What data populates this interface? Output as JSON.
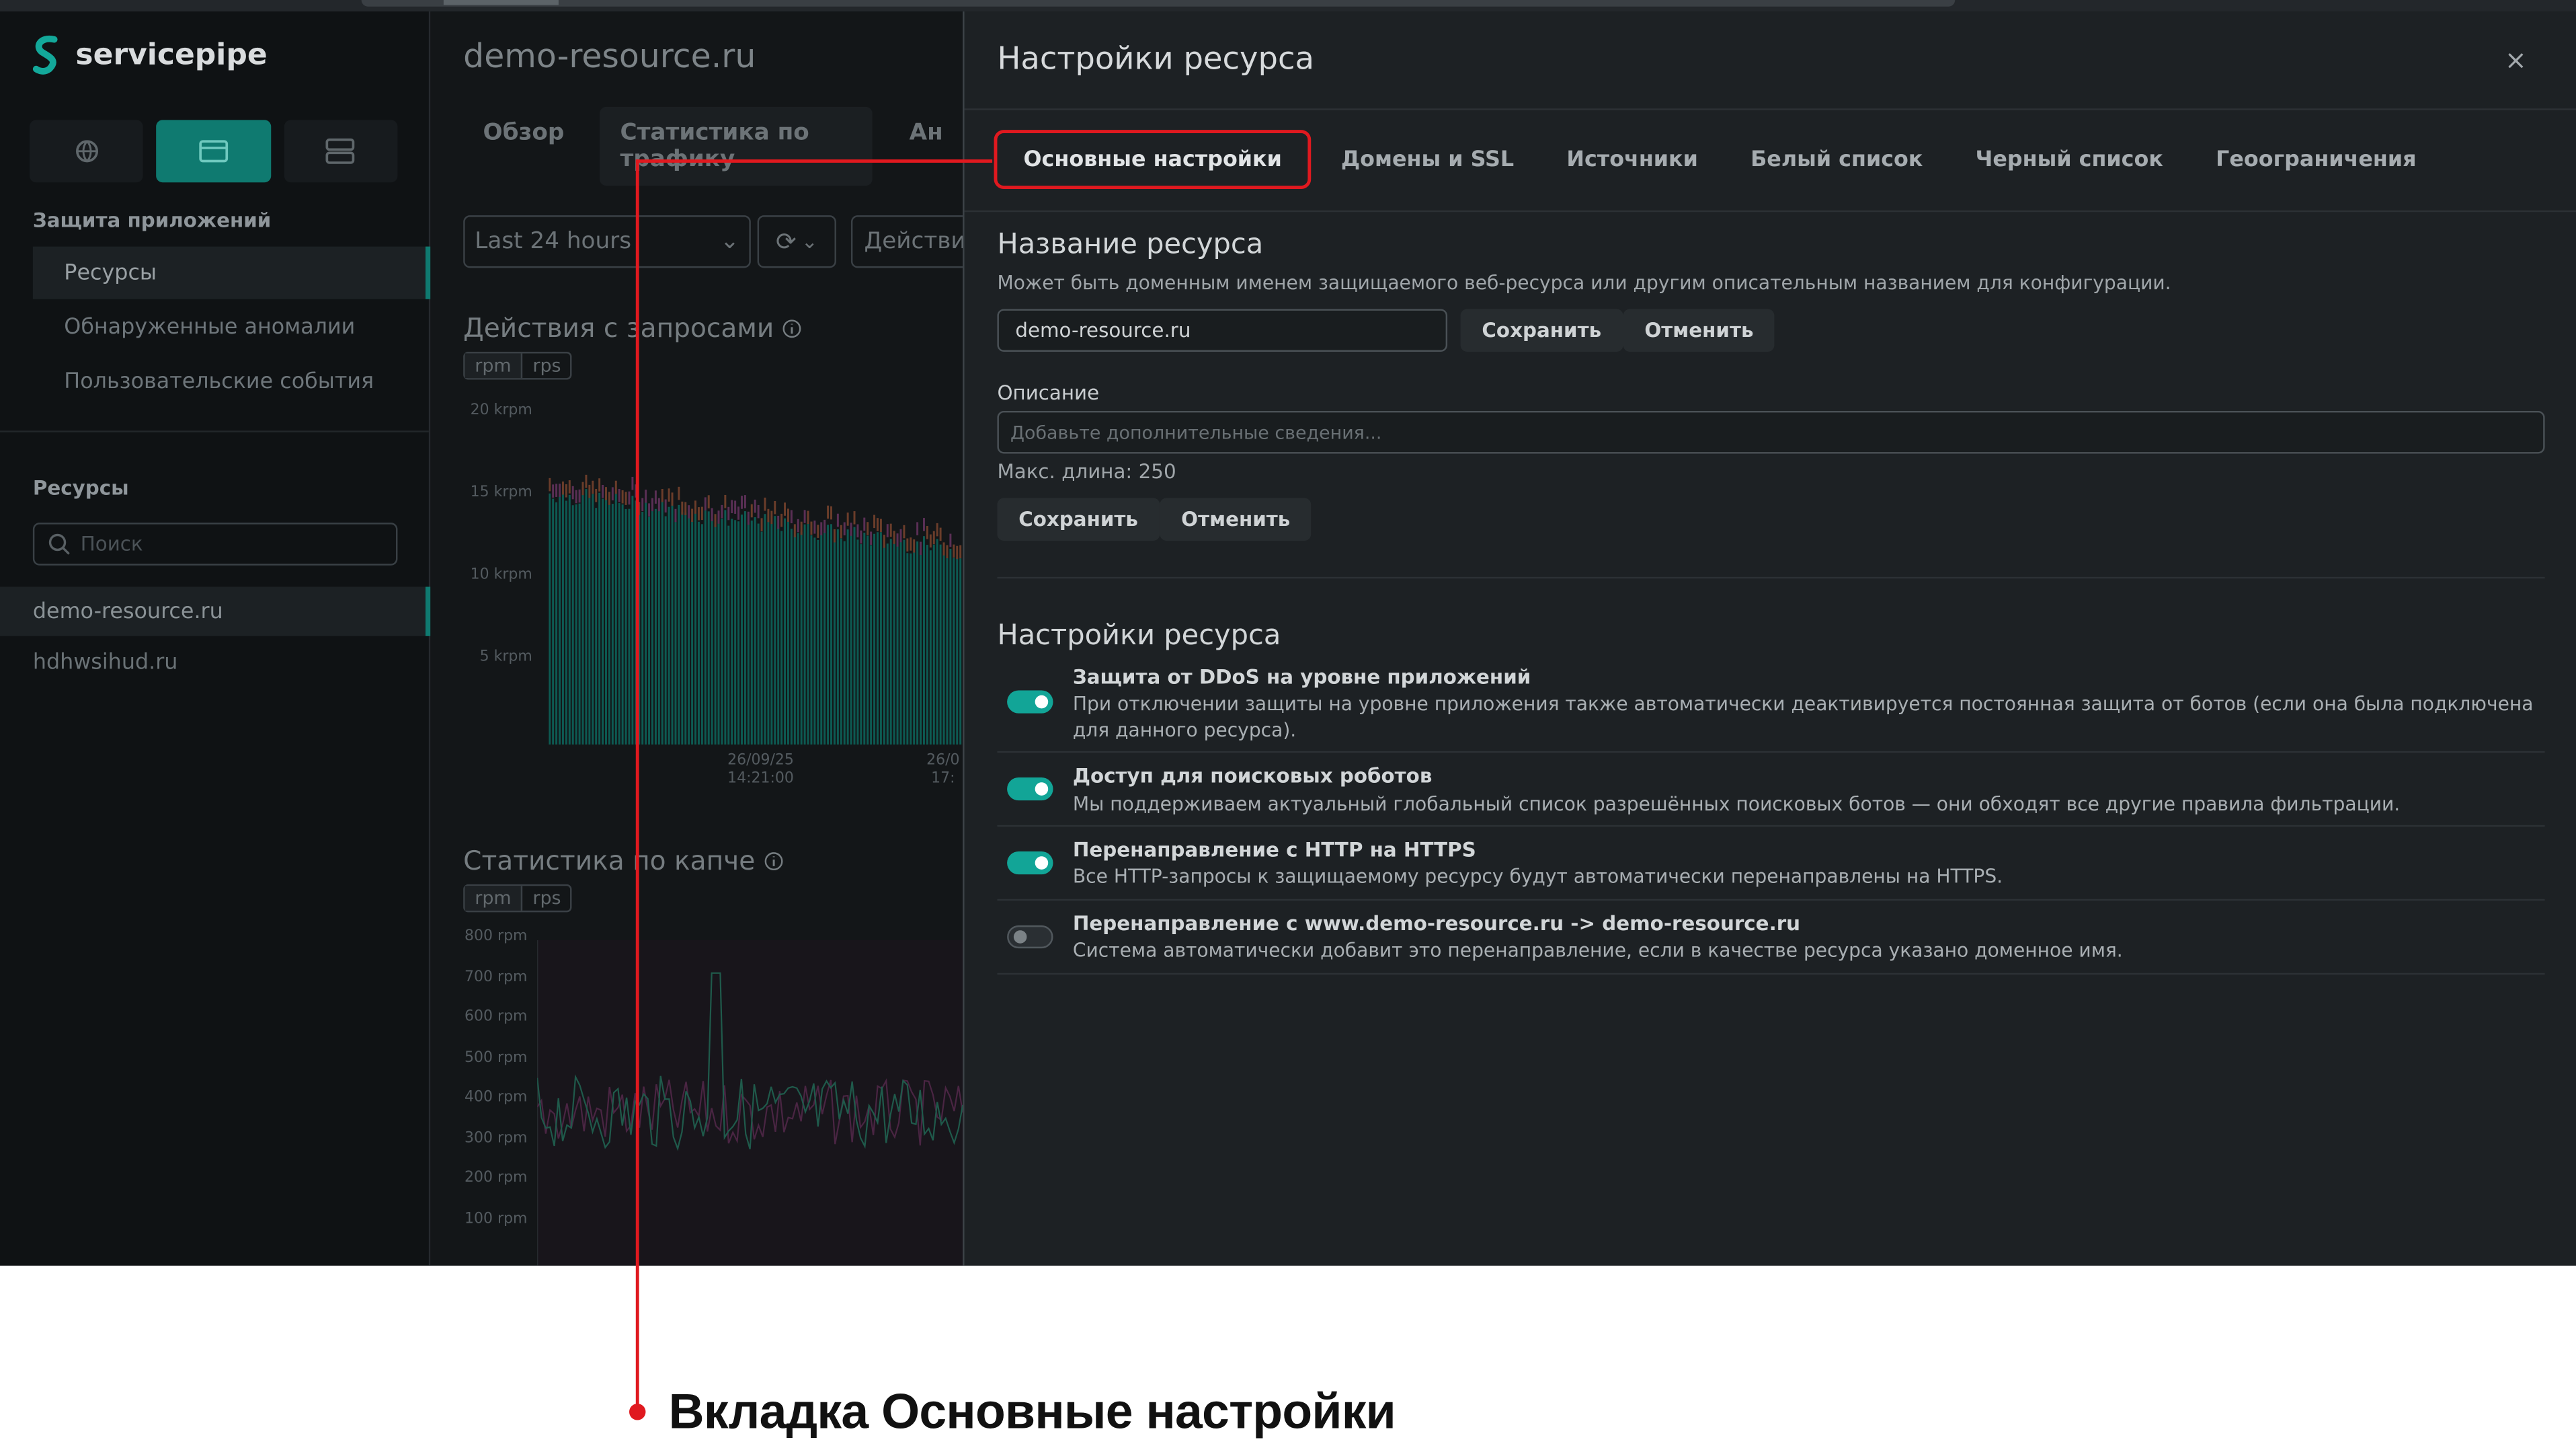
{
  "sidebar": {
    "brand": "servicepipe",
    "section_app_protection": "Защита приложений",
    "nav": [
      {
        "label": "Ресурсы",
        "active": true
      },
      {
        "label": "Обнаруженные аномалии",
        "active": false
      },
      {
        "label": "Пользовательские события",
        "active": false
      }
    ],
    "section_resources": "Ресурсы",
    "search_placeholder": "Поиск",
    "resources": [
      {
        "label": "demo-resource.ru",
        "active": true
      },
      {
        "label": "hdhwsihud.ru",
        "active": false
      }
    ]
  },
  "main": {
    "title": "demo-resource.ru",
    "tabs": [
      "Обзор",
      "Статистика по трафику",
      "Ан"
    ],
    "period": "Last 24 hours",
    "actions": "Действия",
    "chart1": {
      "title": "Действия с запросами",
      "units": [
        "rpm",
        "rps"
      ],
      "yticks": [
        "20 krpm",
        "15 krpm",
        "10 krpm",
        "5 krpm"
      ],
      "xticks": [
        {
          "date": "26/09/25",
          "time": "14:21:00"
        },
        {
          "date": "26/0",
          "time": "17:"
        }
      ]
    },
    "chart2": {
      "title": "Статистика по капче",
      "units": [
        "rpm",
        "rps"
      ],
      "yticks": [
        "800 rpm",
        "700 rpm",
        "600 rpm",
        "500 rpm",
        "400 rpm",
        "300 rpm",
        "200 rpm",
        "100 rpm"
      ]
    }
  },
  "panel": {
    "title": "Настройки ресурса",
    "close": "×",
    "tabs": [
      {
        "label": "Основные настройки",
        "active": true
      },
      {
        "label": "Домены и SSL",
        "active": false
      },
      {
        "label": "Источники",
        "active": false
      },
      {
        "label": "Белый список",
        "active": false
      },
      {
        "label": "Черный список",
        "active": false
      },
      {
        "label": "Геоограничения",
        "active": false
      }
    ],
    "name_section": {
      "title": "Название ресурса",
      "hint": "Может быть доменным именем защищаемого веб-ресурса или другим описательным названием для конфигурации.",
      "value": "demo-resource.ru",
      "save": "Сохранить",
      "cancel": "Отменить"
    },
    "description_section": {
      "label": "Описание",
      "placeholder": "Добавьте дополнительные сведения...",
      "maxlen": "Макс. длина: 250",
      "save": "Сохранить",
      "cancel": "Отменить"
    },
    "settings_section": {
      "title": "Настройки ресурса",
      "items": [
        {
          "title": "Защита от DDoS на уровне приложений",
          "desc": "При отключении защиты на уровне приложения также автоматически деактивируется постоянная защита от ботов (если она была подключена для данного ресурса).",
          "enabled": true
        },
        {
          "title": "Доступ для поисковых роботов",
          "desc": "Мы поддерживаем актуальный глобальный список разрешённых поисковых ботов — они обходят все другие правила фильтрации.",
          "enabled": true
        },
        {
          "title": "Перенаправление с HTTP на HTTPS",
          "desc": "Все HTTP-запросы к защищаемому ресурсу будут автоматически перенаправлены на HTTPS.",
          "enabled": true
        },
        {
          "title": "Перенаправление с www.demo-resource.ru -> demo-resource.ru",
          "desc": "Система автоматически добавит это перенаправление, если в качестве ресурса указано доменное имя.",
          "enabled": false
        }
      ]
    }
  },
  "annotation": {
    "text": "Вкладка Основные настройки",
    "color": "#e0191f"
  },
  "colors": {
    "accent": "#0f7a70",
    "toggle_on": "#12a597",
    "panel_bg": "#1d2124",
    "sidebar_bg": "#0f1214"
  }
}
